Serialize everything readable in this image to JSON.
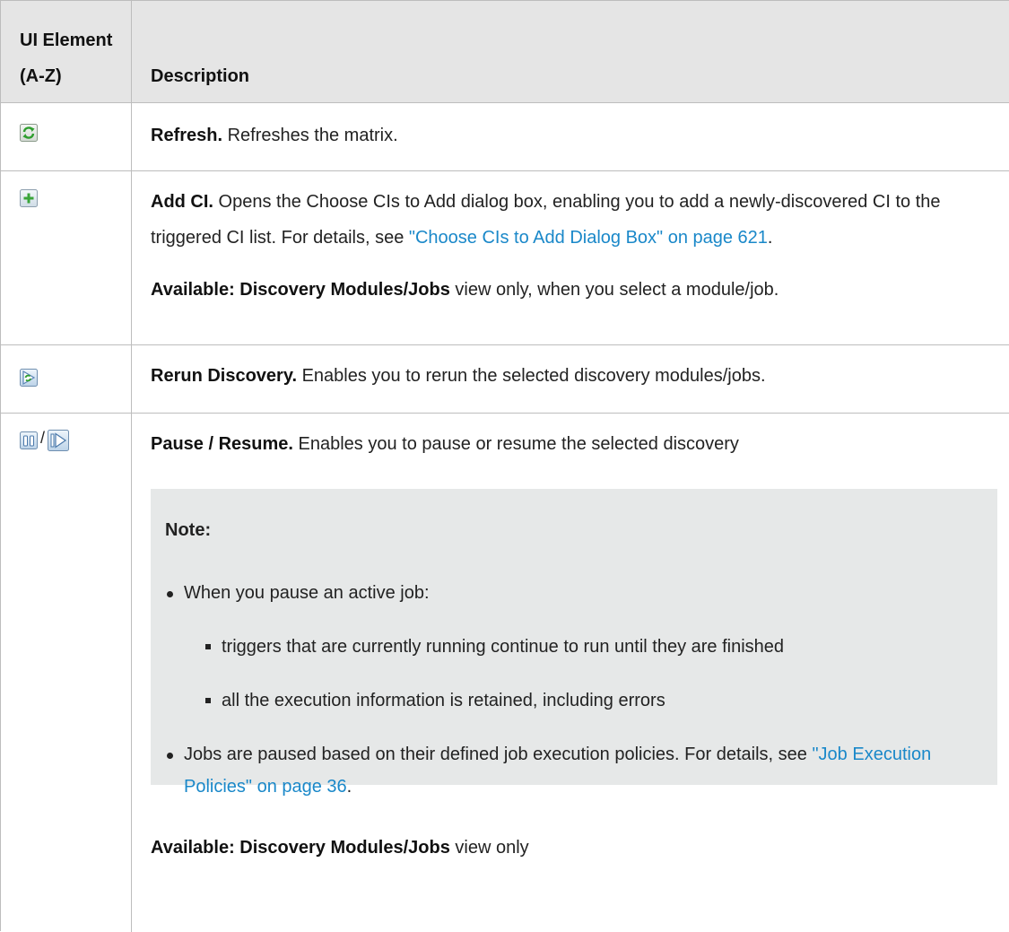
{
  "header": {
    "col1": "UI Element (A-Z)",
    "col2": "Description"
  },
  "rows": [
    {
      "icon": "refresh-icon",
      "title": "Refresh.",
      "text": " Refreshes the matrix."
    },
    {
      "icon": "add-ci-icon",
      "title": "Add CI.",
      "text": " Opens the Choose CIs to Add dialog box, enabling you to add a newly-discovered CI to the triggered CI list. For details, see ",
      "link": "\"Choose CIs to Add Dialog Box\" on page 621",
      "after_link": ".",
      "available_label": "Available: Discovery Modules/Jobs",
      "available_text": " view only, when you select a module/job."
    },
    {
      "icon": "rerun-discovery-icon",
      "title": "Rerun Discovery.",
      "text": " Enables you to rerun the selected discovery modules/jobs."
    },
    {
      "icon": "pause-icon",
      "icon2": "resume-icon",
      "separator": "/",
      "title": "Pause / Resume.",
      "text": " Enables you to pause or resume the selected discovery",
      "note": {
        "title": "Note:",
        "bullet1": "When you pause an active job:",
        "sub1": "triggers that are currently running continue to run until they are finished",
        "sub2": "all the execution information is retained, including errors",
        "bullet2": "Jobs are paused based on their defined job execution policies. For details, see ",
        "bullet2_link": "\"Job Execution Policies\" on page 36",
        "bullet2_after": "."
      },
      "available_label": "Available: Discovery Modules/Jobs",
      "available_text": " view only"
    }
  ],
  "colors": {
    "header_bg": "#e5e5e5",
    "note_bg": "#e6e8e8",
    "link": "#1a88c9",
    "border": "#bdbdbd"
  }
}
